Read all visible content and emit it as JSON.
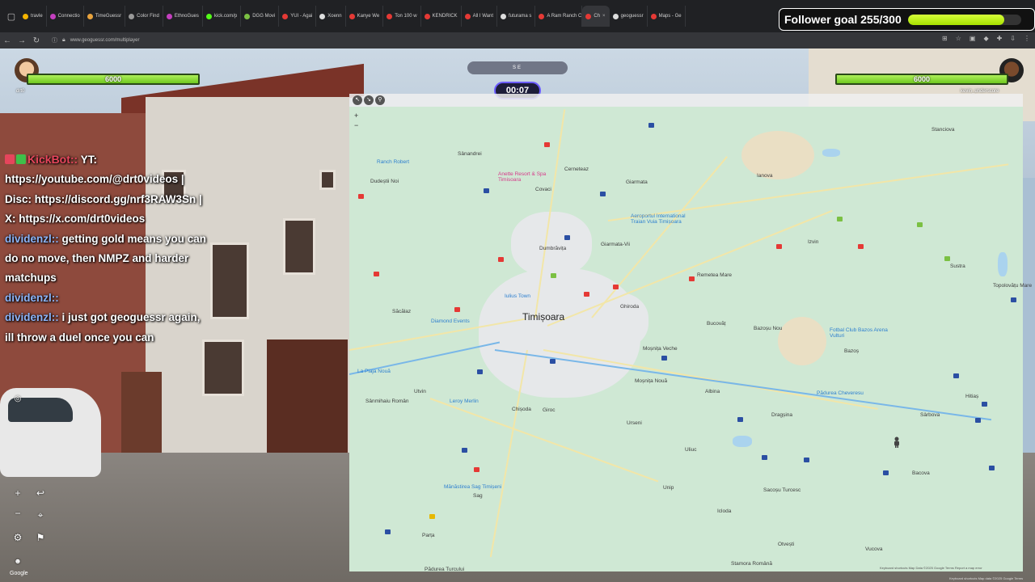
{
  "browser": {
    "tabs": [
      {
        "label": "travle",
        "color": "#f4b400"
      },
      {
        "label": "Connectio",
        "color": "#c43fbf"
      },
      {
        "label": "TimeGuessr",
        "color": "#e8a33d"
      },
      {
        "label": "Color Find",
        "color": "#999999"
      },
      {
        "label": "EthnoGues",
        "color": "#c43fbf"
      },
      {
        "label": "kick.com/p",
        "color": "#53fc18"
      },
      {
        "label": "DGG Movi",
        "color": "#7bc043"
      },
      {
        "label": "YUI - Agai",
        "color": "#e53935"
      },
      {
        "label": "Xoenn",
        "color": "#dddddd"
      },
      {
        "label": "Kanye We",
        "color": "#e53935"
      },
      {
        "label": "Ton 100 w",
        "color": "#e53935"
      },
      {
        "label": "KENDRICK",
        "color": "#e53935"
      },
      {
        "label": "All I Want",
        "color": "#e53935"
      },
      {
        "label": "futurama s",
        "color": "#dddddd"
      },
      {
        "label": "A Ram Ranch C",
        "color": "#e53935"
      },
      {
        "label": "Ch",
        "color": "#e53935"
      },
      {
        "label": "geoguessr",
        "color": "#dddddd"
      },
      {
        "label": "Maps - Ge",
        "color": "#e53935"
      }
    ],
    "url": "www.geoguessr.com/multiplayer"
  },
  "follower_goal": {
    "label": "Follower goal 255/300",
    "current": 255,
    "target": 300
  },
  "hud": {
    "left_player": {
      "name": "drt0",
      "hp": "6000"
    },
    "right_player": {
      "name": "kevin_underscore",
      "hp": "6000"
    },
    "compass": "SE",
    "timer": "00:07"
  },
  "chat": [
    {
      "user": "KickBot",
      "text": "YT: https://youtube.com/@drt0videos | Disc: https://discord.gg/nrf3RAW3Sn | X: https://x.com/drt0videos"
    },
    {
      "user": "dividenzl",
      "text": "getting gold means you can do no move, then NMPZ and harder matchups"
    },
    {
      "user": "dividenzl",
      "text": ""
    },
    {
      "user": "dividenzl",
      "text": "i just got geoguessr again, ill throw a duel once you can"
    }
  ],
  "map": {
    "city": "Timișoara",
    "places": [
      "Stanciova",
      "Sânandrei",
      "Cerneteaz",
      "Giarmata",
      "Ianova",
      "Ranch Robert",
      "Dudeștii Noi",
      "Anette Resort & Spa Timisoara",
      "Covaci",
      "Aeroportul International Traian Vuia Timișoara",
      "Izvin",
      "Sustra",
      "Dumbrăvița",
      "Giarmata-Vii",
      "Remetea Mare",
      "Topolovățu Mare",
      "Săcălaz",
      "Diamond Events",
      "Iulius Town",
      "Ghiroda",
      "Bucovăț",
      "Bazoșu Nou",
      "Fotbal Club Bazos Arena Vulturi",
      "Moșnița Veche",
      "Bazoș",
      "La Plaja Nouă",
      "Utvin",
      "Leroy Merlin",
      "Moșnița Nouă",
      "Albina",
      "Pădurea Cheveresu",
      "Hitiaș",
      "Sânmihaiu Român",
      "Chișoda",
      "Giroc",
      "Urseni",
      "Dragșina",
      "Sârbova",
      "Uliuc",
      "Bacova",
      "Mănăstirea Sag Timișeni",
      "Sag",
      "Unip",
      "Sacoșu Turcesc",
      "Icloda",
      "Parța",
      "Otvești",
      "Vucova",
      "Stamora Română",
      "Pădurea Turcului"
    ],
    "footer": "Keyboard shortcuts   Map Data ©2025 Google   Terms   Report a map error"
  },
  "bottom": {
    "google": "Google",
    "footer_right": "Keyboard shortcuts  Map data ©2025 Google  Terms"
  },
  "colors": {
    "hp": "#8ee03a",
    "follower_fill": "#c5f51f",
    "timer_border": "#6b5cff",
    "chat_bot": "#e6455c",
    "chat_user": "#8ab4f8"
  }
}
